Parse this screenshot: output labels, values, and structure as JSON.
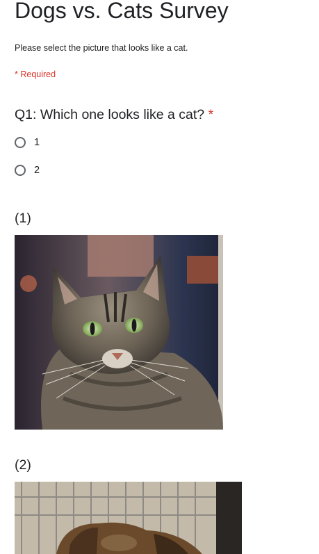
{
  "form": {
    "title": "Dogs vs. Cats Survey",
    "description": "Please select the picture that looks like a cat.",
    "required_note": "* Required"
  },
  "question": {
    "title": "Q1: Which one looks like a cat?",
    "required_marker": "*",
    "options": [
      {
        "label": "1",
        "selected": false
      },
      {
        "label": "2",
        "selected": false
      }
    ]
  },
  "images": [
    {
      "caption": "(1)",
      "subject": "tabby-cat-photo"
    },
    {
      "caption": "(2)",
      "subject": "dog-in-crate-photo"
    }
  ],
  "colors": {
    "text": "#202124",
    "required": "#d93025",
    "radio_border": "#5f6368"
  }
}
